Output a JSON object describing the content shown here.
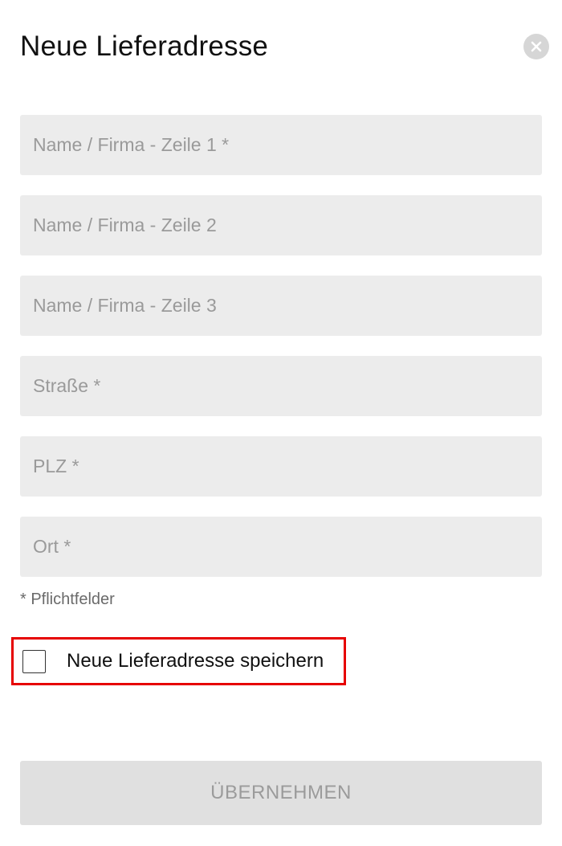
{
  "dialog": {
    "title": "Neue Lieferadresse",
    "close_icon": "close-icon"
  },
  "form": {
    "fields": [
      {
        "name": "name-line-1-field",
        "placeholder": "Name / Firma - Zeile 1 *",
        "value": ""
      },
      {
        "name": "name-line-2-field",
        "placeholder": "Name / Firma - Zeile 2",
        "value": ""
      },
      {
        "name": "name-line-3-field",
        "placeholder": "Name / Firma - Zeile 3",
        "value": ""
      },
      {
        "name": "street-field",
        "placeholder": "Straße *",
        "value": ""
      },
      {
        "name": "zip-field",
        "placeholder": "PLZ *",
        "value": ""
      },
      {
        "name": "city-field",
        "placeholder": "Ort *",
        "value": ""
      }
    ],
    "required_note": "* Pflichtfelder",
    "save_checkbox": {
      "label": "Neue Lieferadresse speichern",
      "checked": false,
      "highlight_color": "#e60000"
    },
    "submit_label": "ÜBERNEHMEN"
  },
  "colors": {
    "field_background": "#ececec",
    "placeholder": "#9a9a9a",
    "button_background": "#e0e0e0",
    "button_text": "#9b9b9b",
    "close_background": "#d6d6d6"
  }
}
